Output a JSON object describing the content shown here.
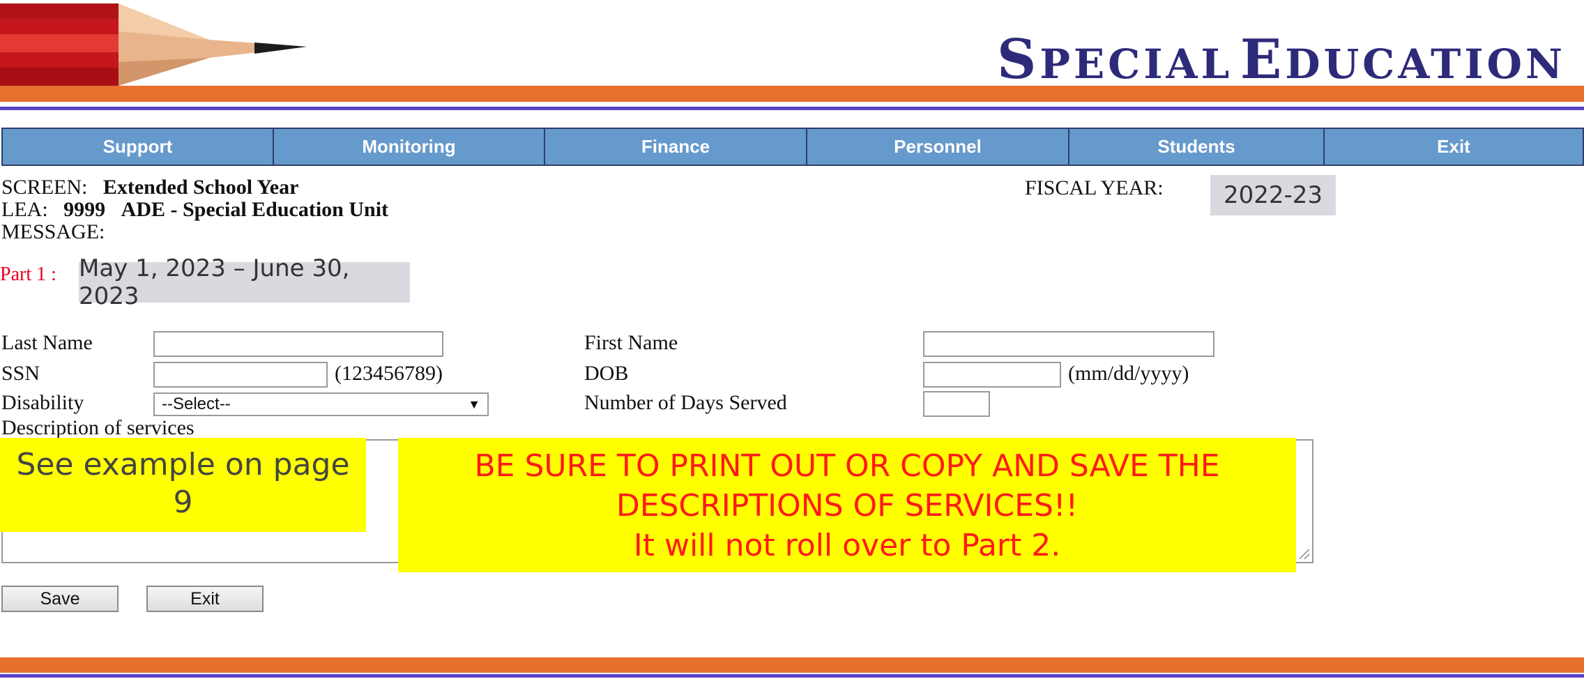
{
  "header": {
    "title_first_cap": "S",
    "title_first_rest": "PECIAL",
    "title_second_cap": "E",
    "title_second_rest": "DUCATION",
    "logo": "pencil-icon"
  },
  "nav": {
    "items": [
      {
        "label": "Support"
      },
      {
        "label": "Monitoring"
      },
      {
        "label": "Finance"
      },
      {
        "label": "Personnel"
      },
      {
        "label": "Students"
      },
      {
        "label": "Exit"
      }
    ]
  },
  "info": {
    "screen_label": "SCREEN:",
    "screen_value": "Extended School Year",
    "lea_label": "LEA:",
    "lea_code": "9999",
    "lea_name": "ADE - Special Education Unit",
    "message_label": "MESSAGE:",
    "fiscal_year_label": "FISCAL YEAR:",
    "fiscal_year_value": "2022-23",
    "part_label": "Part 1 :",
    "part_dates": "May 1, 2023 –  June 30, 2023"
  },
  "form": {
    "last_name_label": "Last Name",
    "last_name_value": "",
    "first_name_label": "First Name",
    "first_name_value": "",
    "ssn_label": "SSN",
    "ssn_value": "",
    "ssn_hint": "(123456789)",
    "dob_label": "DOB",
    "dob_value": "",
    "dob_hint": "(mm/dd/yyyy)",
    "disability_label": "Disability",
    "disability_selected": "--Select--",
    "days_served_label": "Number of Days Served",
    "days_served_value": "",
    "description_label": "Description of services"
  },
  "callouts": {
    "left_line1": "See example on page",
    "left_line2": "9",
    "right_line1": "BE SURE TO PRINT OUT OR COPY AND SAVE THE",
    "right_line2": "DESCRIPTIONS OF SERVICES!!",
    "right_line3": "It will not roll over to Part 2."
  },
  "buttons": {
    "save": "Save",
    "exit": "Exit"
  },
  "colors": {
    "orange_bar": "#e8702e",
    "blue_line": "#5a45c8",
    "nav_bg": "#6699cc",
    "title": "#2e2a7a",
    "callout": "#ffff00",
    "warning_text": "#ff1a1a",
    "part_label": "#e8001c"
  }
}
